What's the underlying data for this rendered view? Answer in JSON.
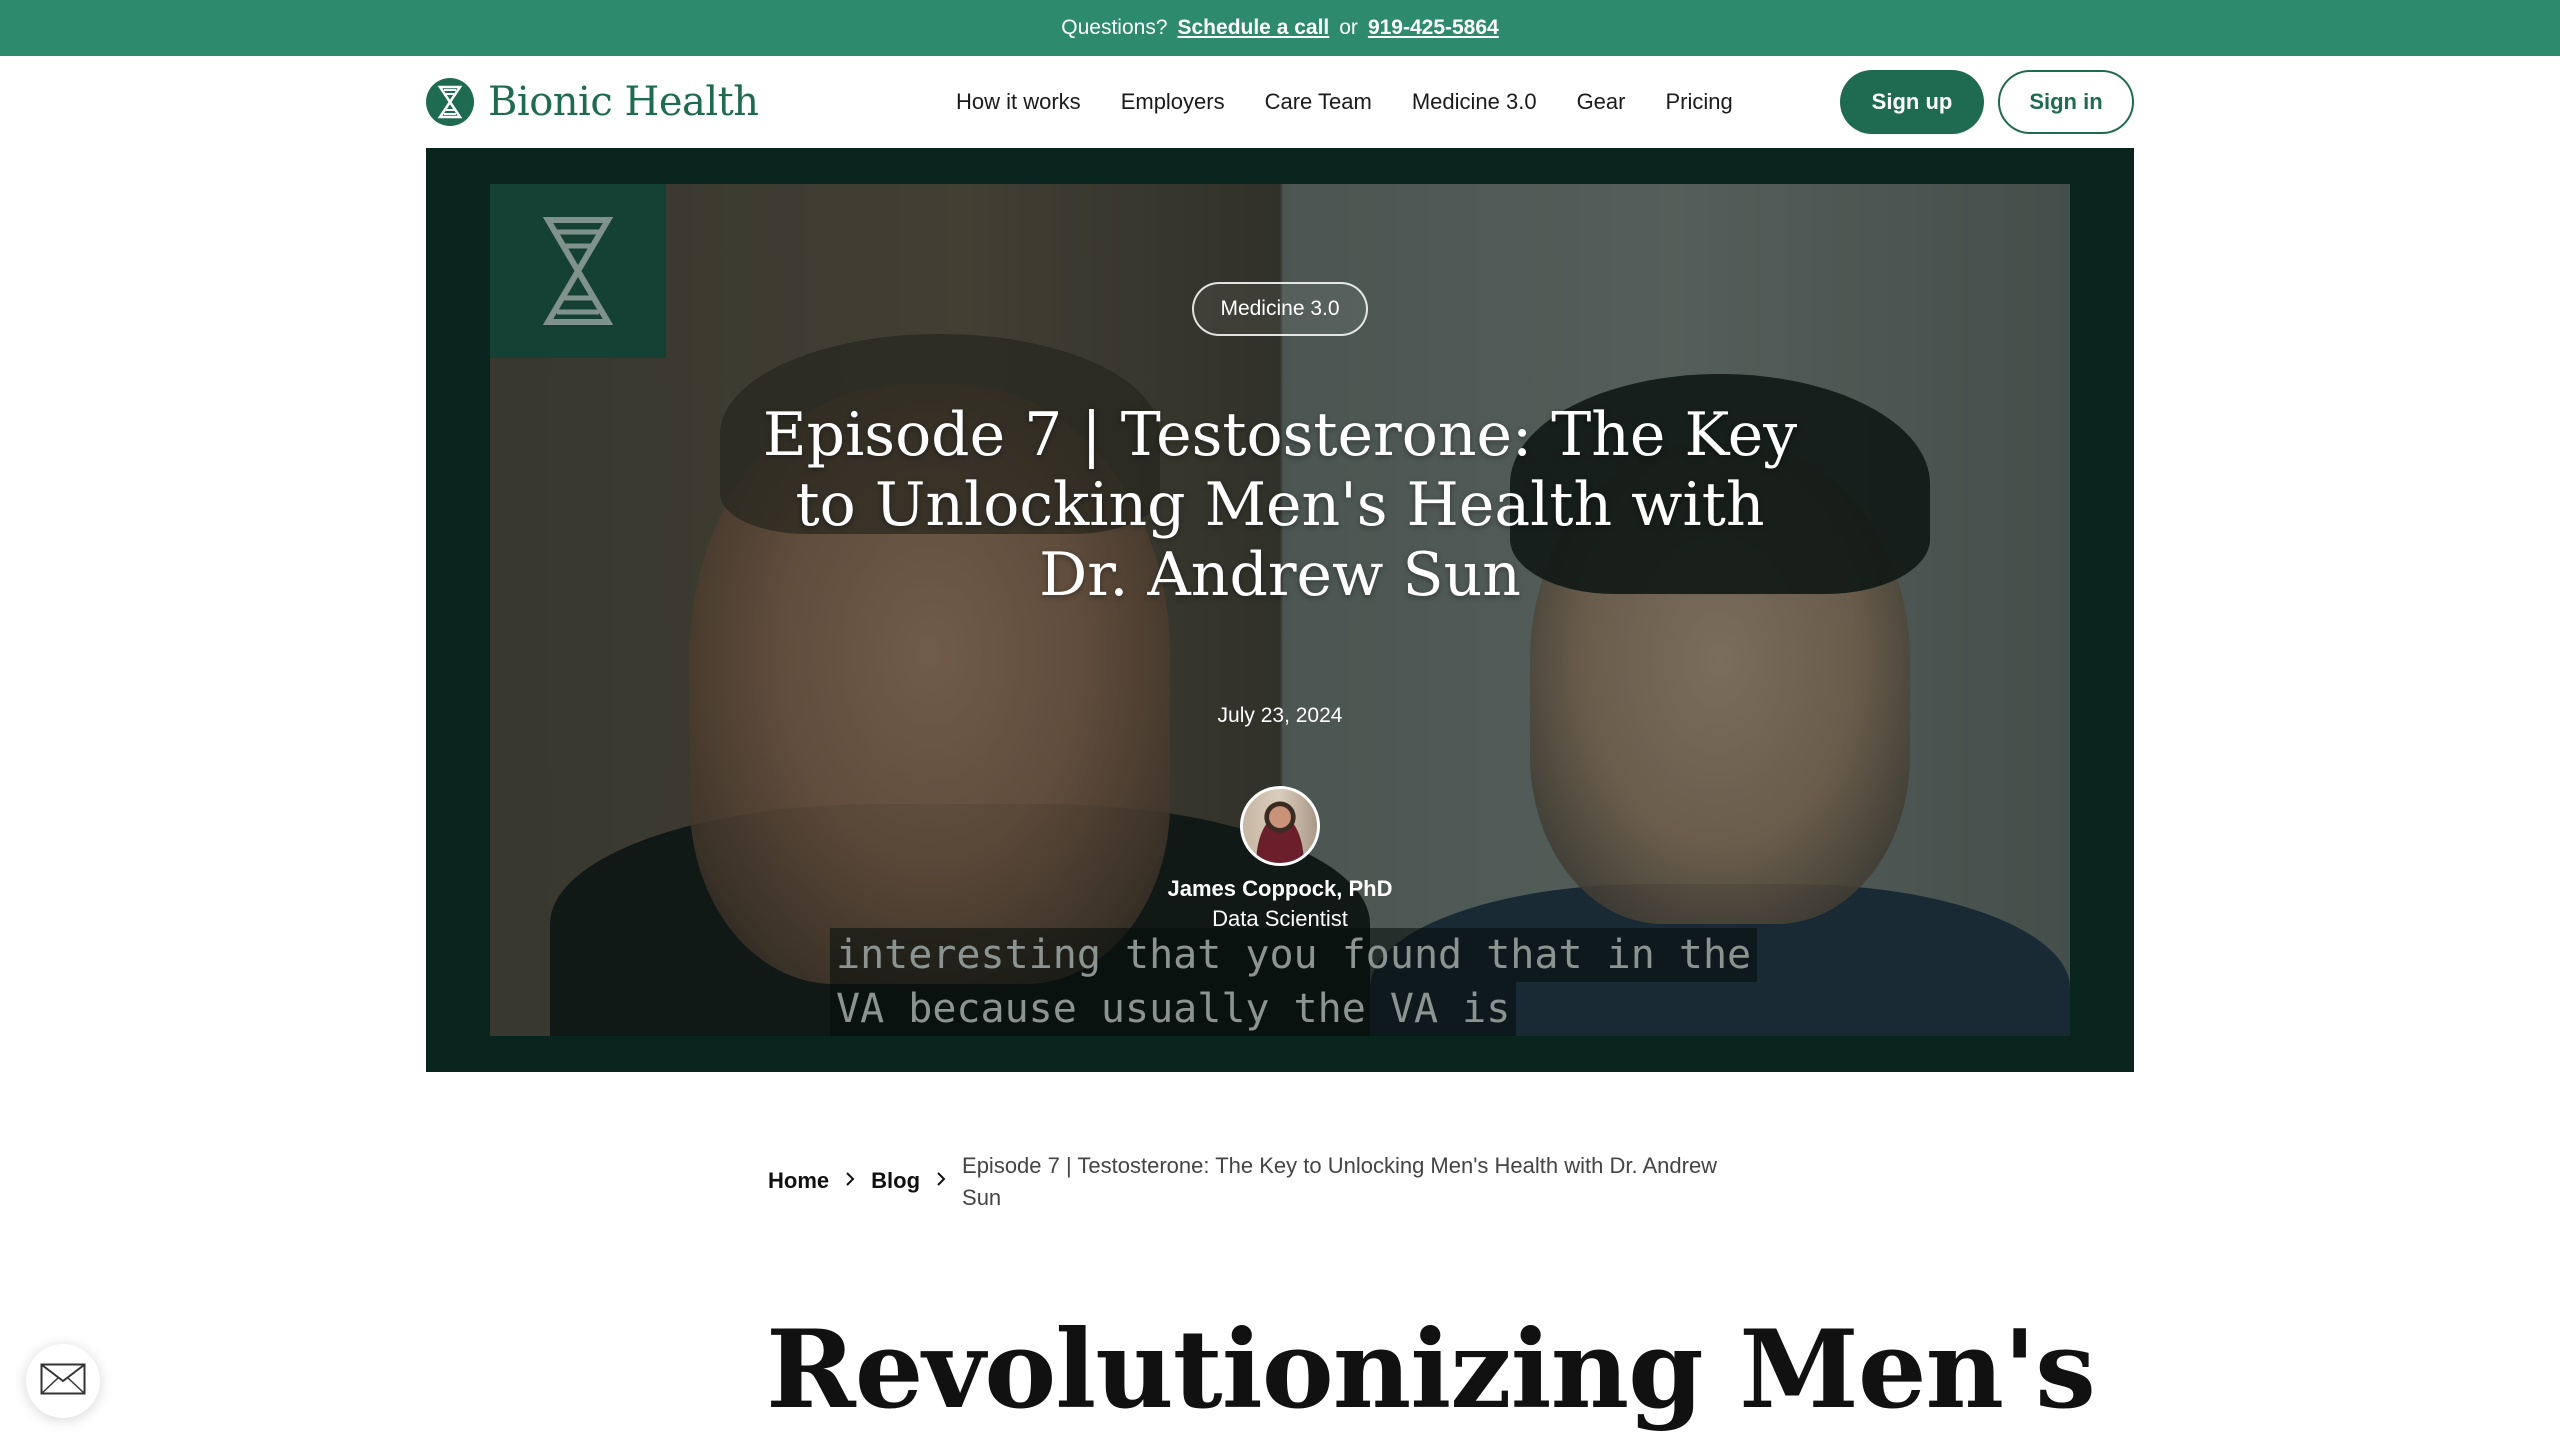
{
  "announcement": {
    "prefix": "Questions?",
    "schedule_link": "Schedule a call",
    "or_text": "or",
    "phone_link": "919-425-5864"
  },
  "header": {
    "brand": "Bionic Health",
    "nav": [
      "How it works",
      "Employers",
      "Care Team",
      "Medicine 3.0",
      "Gear",
      "Pricing"
    ],
    "signup_label": "Sign up",
    "signin_label": "Sign in"
  },
  "hero": {
    "tag": "Medicine 3.0",
    "title": "Episode 7 | Testosterone: The Key to Unlocking Men's Health with Dr. Andrew Sun",
    "date": "July 23, 2024",
    "author_name": "James Coppock, PhD",
    "author_role": "Data Scientist",
    "video_caption_line1": "interesting that you found that in the",
    "video_caption_line2": "VA because usually the VA is"
  },
  "breadcrumb": {
    "home": "Home",
    "blog": "Blog",
    "current": "Episode 7 | Testosterone: The Key to Unlocking Men's Health with Dr. Andrew Sun"
  },
  "article": {
    "heading": "Revolutionizing Men's"
  },
  "colors": {
    "brand_green": "#1f6b52",
    "topbar_green": "#2e8a6d",
    "hero_bg": "#0b2a22"
  },
  "icons": {
    "logo": "hourglass-dna-icon",
    "chat": "mail-icon",
    "chevron": "chevron-right-icon"
  }
}
